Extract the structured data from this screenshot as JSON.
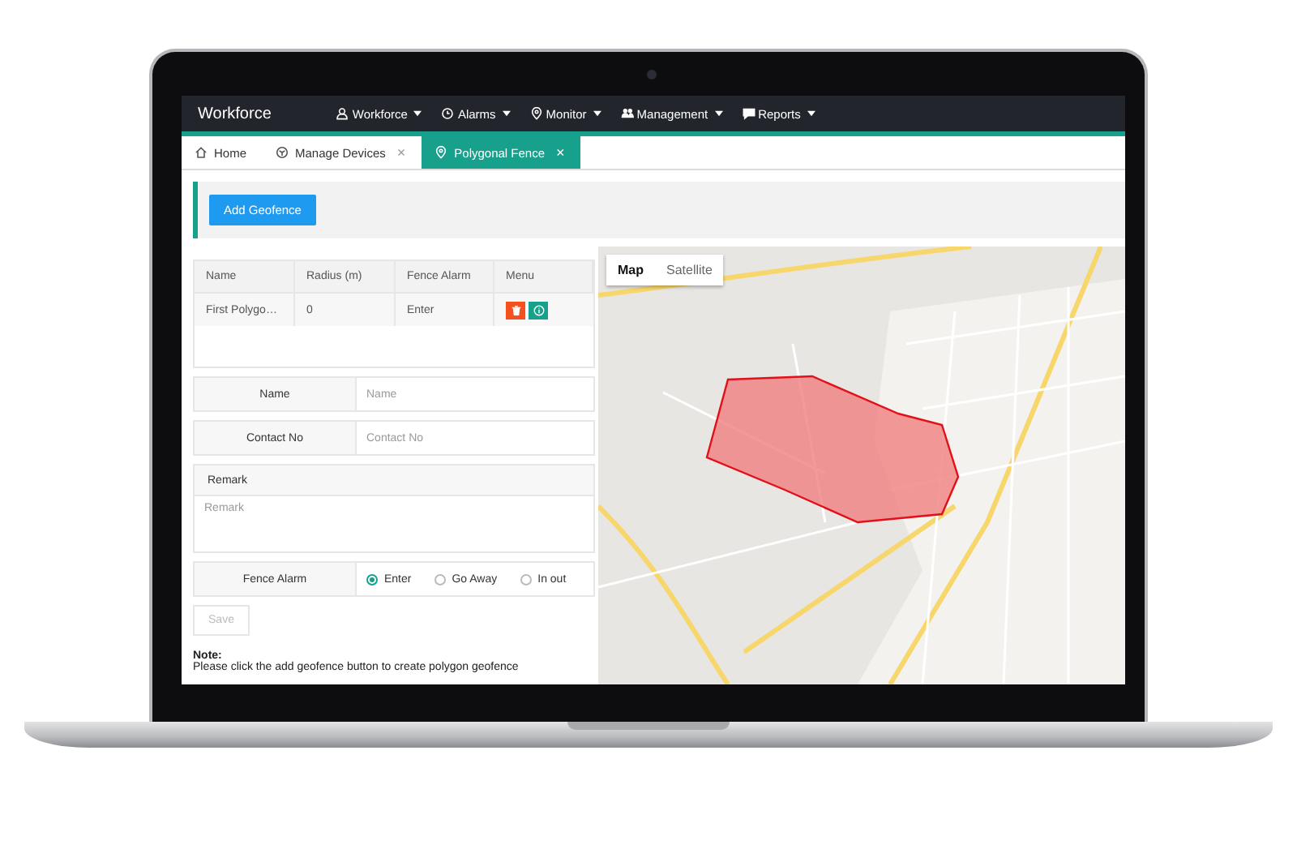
{
  "app_title": "Workforce",
  "nav": [
    {
      "label": "Workforce"
    },
    {
      "label": "Alarms"
    },
    {
      "label": "Monitor"
    },
    {
      "label": "Management"
    },
    {
      "label": "Reports"
    }
  ],
  "tabs": [
    {
      "label": "Home",
      "selected": false
    },
    {
      "label": "Manage Devices",
      "close": "×",
      "selected": false
    },
    {
      "label": "Polygonal Fence",
      "close": "×",
      "selected": true
    }
  ],
  "add_button": "Add Geofence",
  "table": {
    "columns": [
      "Name",
      "Radius (m)",
      "Fence Alarm",
      "Menu"
    ],
    "rows": [
      {
        "cells": [
          "First Polygo…",
          "0",
          "Enter"
        ]
      }
    ]
  },
  "form": {
    "fields": [
      {
        "label": "Name",
        "placeholder": "Name"
      },
      {
        "label": "Contact No",
        "placeholder": "Contact No"
      }
    ],
    "remark": {
      "label": "Remark",
      "placeholder": "Remark"
    },
    "fence_alarm": {
      "label": "Fence Alarm",
      "options": [
        {
          "label": "Enter",
          "selected": true
        },
        {
          "label": "Go Away",
          "selected": false
        },
        {
          "label": "In out",
          "selected": false
        }
      ]
    },
    "save_button": {
      "label": "Save",
      "disabled": true
    }
  },
  "note": {
    "title": "Note:",
    "text": "Please click the add geofence button to create polygon geofence"
  },
  "map": {
    "tabs": [
      {
        "label": "Map",
        "selected": true
      },
      {
        "label": "Satellite",
        "selected": false
      }
    ]
  }
}
